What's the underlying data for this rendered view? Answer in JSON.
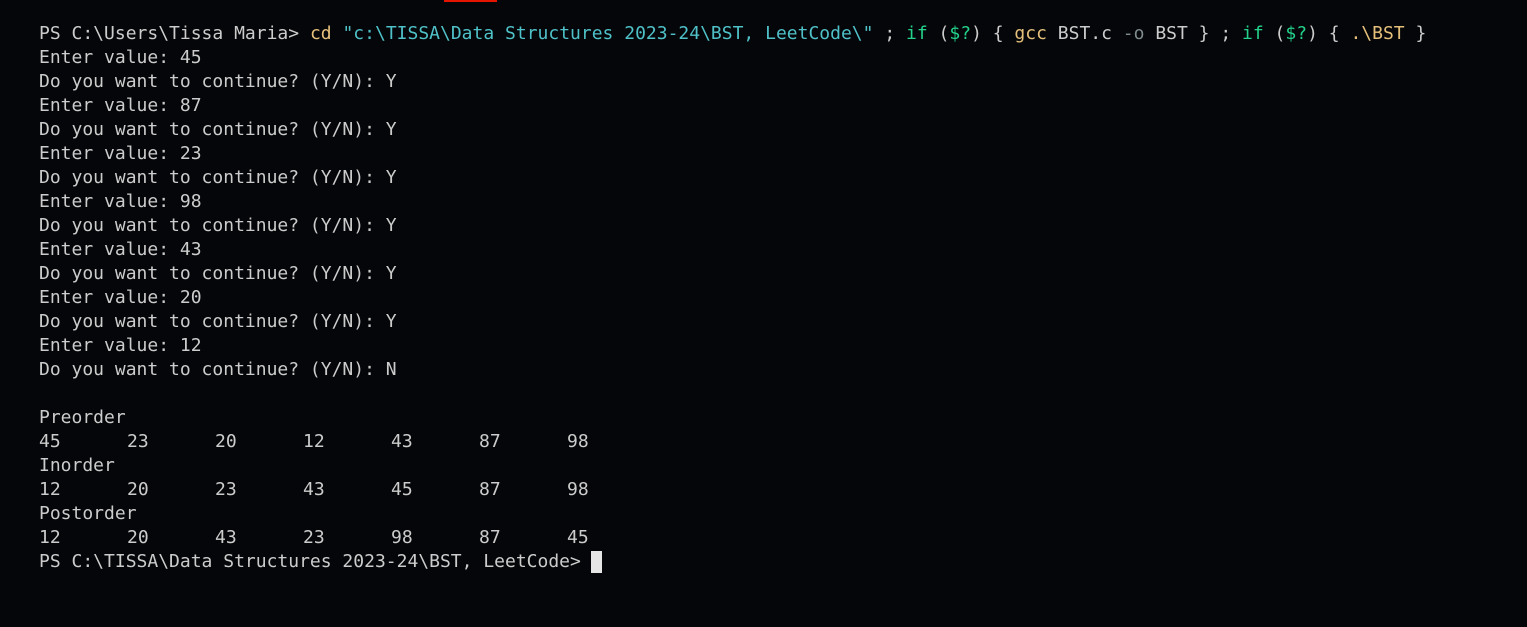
{
  "terminal": {
    "command": {
      "prompt": "PS C:\\Users\\Tissa Maria> ",
      "cd": "cd",
      "space1": " ",
      "path": "\"c:\\TISSA\\Data Structures 2023-24\\BST, LeetCode\\\"",
      "sep1": " ; ",
      "if1": "if",
      "cond1_open": " (",
      "cond1_var": "$?",
      "cond1_close": ") { ",
      "gcc": "gcc",
      "gcc_args1": " BST.c ",
      "flag_o": "-o",
      "gcc_args2": " BST } ; ",
      "if2": "if",
      "cond2_open": " (",
      "cond2_var": "$?",
      "cond2_close": ") { ",
      "run": ".\\BST",
      "end": " }"
    },
    "session": [
      "Enter value: 45",
      "Do you want to continue? (Y/N): Y",
      "Enter value: 87",
      "Do you want to continue? (Y/N): Y",
      "Enter value: 23",
      "Do you want to continue? (Y/N): Y",
      "Enter value: 98",
      "Do you want to continue? (Y/N): Y",
      "Enter value: 43",
      "Do you want to continue? (Y/N): Y",
      "Enter value: 20",
      "Do you want to continue? (Y/N): Y",
      "Enter value: 12",
      "Do you want to continue? (Y/N): N"
    ],
    "traversals": [
      {
        "label": "Preorder",
        "values": [
          "45",
          "23",
          "20",
          "12",
          "43",
          "87",
          "98"
        ]
      },
      {
        "label": "Inorder",
        "values": [
          "12",
          "20",
          "23",
          "43",
          "45",
          "87",
          "98"
        ]
      },
      {
        "label": "Postorder",
        "values": [
          "12",
          "20",
          "43",
          "23",
          "98",
          "87",
          "45"
        ]
      }
    ],
    "final_prompt": "PS C:\\TISSA\\Data Structures 2023-24\\BST, LeetCode>"
  },
  "colors": {
    "background": "#050609",
    "text": "#cccccc",
    "command": "#e5c07b",
    "string": "#4fc1c8",
    "keyword": "#23d18b",
    "accent": "#e51400"
  }
}
